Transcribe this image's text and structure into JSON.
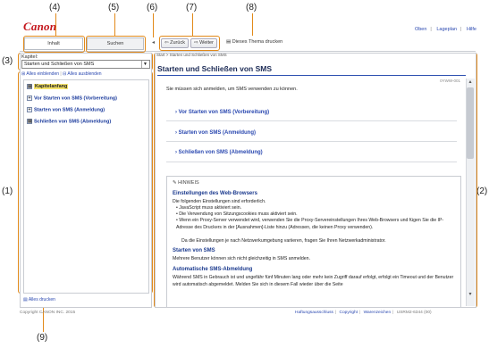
{
  "callouts": {
    "c1": "(1)",
    "c2": "(2)",
    "c3": "(3)",
    "c4": "(4)",
    "c5": "(5)",
    "c6": "(6)",
    "c7": "(7)",
    "c8": "(8)",
    "c9": "(9)"
  },
  "header": {
    "logo": "Canon",
    "links": [
      "Oben",
      "Lageplan",
      "Hilfe"
    ]
  },
  "tabs": {
    "contents": "Inhalt",
    "search": "Suchen"
  },
  "nav": {
    "back": "Zurück",
    "forward": "Weiter",
    "print": "Dieses Thema drucken"
  },
  "sidebar": {
    "chapter_label": "Kapitel:",
    "chapter_value": "Starten und Schließen von SMS",
    "show_all": "Alles einblenden",
    "hide_all": "Alles ausblenden",
    "items": [
      "Kapitelanfang",
      "Vor Starten von SMS (Vorbereitung)",
      "Starten von SMS (Anmeldung)",
      "Schließen von SMS (Abmeldung)"
    ],
    "print_all": "Alles drucken"
  },
  "content": {
    "breadcrumb": "Start > Starten und Schließen von SMS",
    "title": "Starten und Schließen von SMS",
    "doc_id": "0YWW-001",
    "intro": "Sie müssen sich anmelden, um SMS verwenden zu können.",
    "links": [
      "Vor Starten von SMS (Vorbereitung)",
      "Starten von SMS (Anmeldung)",
      "Schließen von SMS (Abmeldung)"
    ],
    "note": {
      "heading": "HINWEIS",
      "sub1": "Einstellungen des Web-Browsers",
      "sub1_text": "Die folgenden Einstellungen sind erforderlich.",
      "bullets": [
        "JavaScript muss aktiviert sein.",
        "Die Verwendung von Sitzungscookies muss aktiviert sein.",
        "Wenn ein Proxy-Server verwendet wird, verwenden Sie die Proxy-Servereinstellungen Ihres Web-Browsers und fügen Sie die IP-Adresse des Druckers in der [Ausnahmen]-Liste hinzu (Adressen, die keinen Proxy verwenden).",
        "Da die Einstellungen je nach Netzwerkumgebung variieren, fragen Sie Ihren Netzwerkadministrator."
      ],
      "sub2": "Starten von SMS",
      "sub2_text": "Mehrere Benutzer können sich nicht gleichzeitig in SMS anmelden.",
      "sub3": "Automatische SMS-Abmeldung",
      "sub3_text": "Während SMS in Gebrauch ist und ungefähr fünf Minuten lang oder mehr kein Zugriff darauf erfolgt, erfolgt ein Timeout und der Benutzer wird automatisch abgemeldet. Melden Sie sich in diesem Fall wieder über die Seite"
    }
  },
  "footer": {
    "copyright": "Copyright CANON INC. 2015",
    "links": [
      "Haftungsausschluss",
      "Copyright",
      "Warenzeichen"
    ],
    "code": "USRM2-6344 (00)"
  }
}
